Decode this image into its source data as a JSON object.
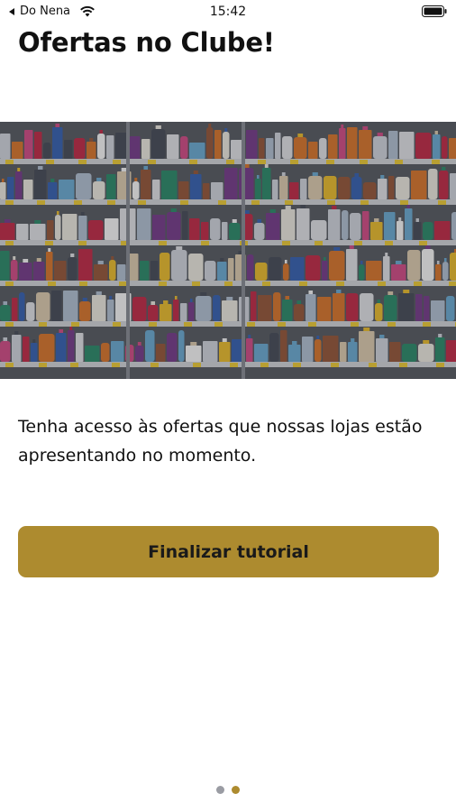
{
  "status_bar": {
    "carrier": "Do Nena",
    "time": "15:42"
  },
  "page": {
    "title": "Ofertas no Clube!",
    "description": "Tenha acesso às ofertas que nossas lojas estão apresentando no momento.",
    "finish_button_label": "Finalizar tutorial"
  },
  "pager": {
    "pages": 2,
    "active_index": 1,
    "colors": {
      "inactive": "#9a9ca3",
      "active": "#ad8b2f"
    }
  },
  "colors": {
    "accent": "#ad8b2f",
    "text": "#111111"
  },
  "hero": {
    "subject": "supermarket shelves with products"
  }
}
